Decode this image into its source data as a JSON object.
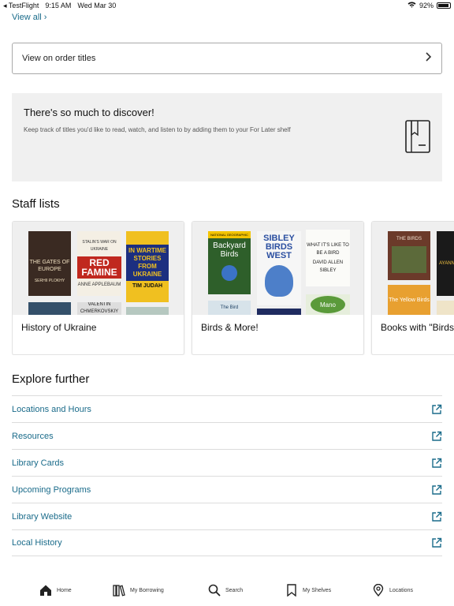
{
  "status_bar": {
    "back_app": "◂ TestFlight",
    "time": "9:15 AM",
    "date": "Wed Mar 30",
    "battery": "92%"
  },
  "view_all": "View all ›",
  "order_titles": {
    "label": "View on order titles"
  },
  "discover": {
    "title": "There's so much to discover!",
    "description": "Keep track of titles you'd like to read, watch, and listen to by adding them to your For Later shelf"
  },
  "staff_lists": {
    "title": "Staff lists",
    "cards": [
      {
        "label": "History of Ukraine",
        "covers": [
          {
            "title": "THE GATES OF EUROPE",
            "author": "SERHII PLOKHY"
          },
          {
            "title": "RED FAMINE",
            "subtitle": "STALIN'S WAR ON UKRAINE",
            "author": "ANNE APPLEBAUM"
          },
          {
            "title": "IN WARTIME STORIES FROM UKRAINE",
            "author": "TIM JUDAH"
          },
          {
            "title": "",
            "author": ""
          },
          {
            "title": "",
            "author": "VALENTIN CHMERKOVSKIY"
          },
          {
            "title": "",
            "author": ""
          }
        ]
      },
      {
        "label": "Birds & More!",
        "covers": [
          {
            "title": "Backyard Birds",
            "subtitle": "NATIONAL GEOGRAPHIC"
          },
          {
            "title": "SIBLEY BIRDS WEST"
          },
          {
            "title": "WHAT IT'S LIKE TO BE A BIRD",
            "author": "DAVID ALLEN SIBLEY"
          },
          {
            "title": "The Bird"
          },
          {
            "title": ""
          },
          {
            "title": "Mano"
          }
        ]
      },
      {
        "label": "Books with \"Birds\" in the Title",
        "covers": [
          {
            "title": "THE BIRDS"
          },
          {
            "title": ""
          },
          {
            "title": "The Yellow Birds"
          },
          {
            "title": "AYANNA"
          }
        ]
      }
    ]
  },
  "explore": {
    "title": "Explore further",
    "items": [
      {
        "label": "Locations and Hours"
      },
      {
        "label": "Resources"
      },
      {
        "label": "Library Cards"
      },
      {
        "label": "Upcoming Programs"
      },
      {
        "label": "Library Website"
      },
      {
        "label": "Local History"
      }
    ]
  },
  "tabbar": {
    "items": [
      {
        "label": "Home",
        "icon": "home-icon"
      },
      {
        "label": "My Borrowing",
        "icon": "books-icon"
      },
      {
        "label": "Search",
        "icon": "search-icon"
      },
      {
        "label": "My Shelves",
        "icon": "bookmark-icon"
      },
      {
        "label": "Locations",
        "icon": "location-pin-icon"
      }
    ]
  },
  "colors": {
    "link": "#1a6b8a",
    "panel": "#f0f0f0",
    "divider": "#dcdcdc"
  }
}
